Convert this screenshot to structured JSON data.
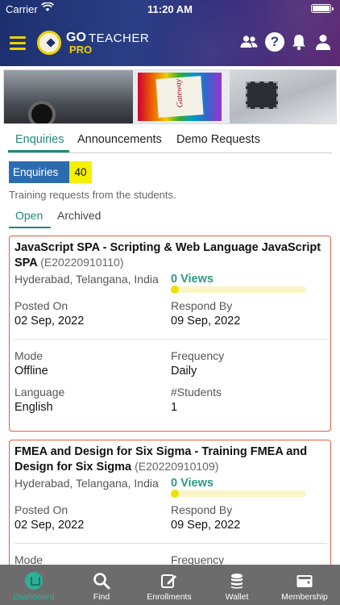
{
  "status_bar": {
    "carrier": "Carrier",
    "time": "11:20 AM"
  },
  "header": {
    "logo_go": "GO",
    "logo_teacher": "TEACHER",
    "logo_pro": "PRO",
    "icons": [
      "menu-icon",
      "users-icon",
      "help-icon",
      "bell-icon",
      "profile-icon"
    ]
  },
  "banner": {
    "board_text": "Gateway"
  },
  "tabs": [
    {
      "label": "Enquiries",
      "active": true
    },
    {
      "label": "Announcements",
      "active": false
    },
    {
      "label": "Demo Requests",
      "active": false
    }
  ],
  "enquiries": {
    "label": "Enquiries",
    "count": "40",
    "subtitle": "Training requests from the students.",
    "subtabs": [
      {
        "label": "Open",
        "active": true
      },
      {
        "label": "Archived",
        "active": false
      }
    ]
  },
  "cards": [
    {
      "title": "JavaScript SPA - Scripting & Web Language JavaScript SPA",
      "code": "(E20220910110)",
      "location": "Hyderabad, Telangana, India",
      "views": "0 Views",
      "posted_on_label": "Posted On",
      "posted_on": "02 Sep, 2022",
      "respond_by_label": "Respond By",
      "respond_by": "09 Sep, 2022",
      "mode_label": "Mode",
      "mode": "Offline",
      "frequency_label": "Frequency",
      "frequency": "Daily",
      "language_label": "Language",
      "language": "English",
      "students_label": "#Students",
      "students": "1"
    },
    {
      "title": "FMEA and Design for Six Sigma - Training FMEA and Design for Six Sigma",
      "code": "(E20220910109)",
      "location": "Hyderabad, Telangana, India",
      "views": "0 Views",
      "posted_on_label": "Posted On",
      "posted_on": "02 Sep, 2022",
      "respond_by_label": "Respond By",
      "respond_by": "09 Sep, 2022",
      "mode_label": "Mode",
      "frequency_label": "Frequency"
    }
  ],
  "bottom_nav": [
    {
      "label": "Dashboard",
      "icon": "home-icon",
      "active": true
    },
    {
      "label": "Find",
      "icon": "search-icon",
      "active": false
    },
    {
      "label": "Enrollments",
      "icon": "edit-icon",
      "active": false
    },
    {
      "label": "Wallet",
      "icon": "coins-icon",
      "active": false
    },
    {
      "label": "Membership",
      "icon": "wallet-icon",
      "active": false
    }
  ],
  "colors": {
    "accent": "#1f8a7a",
    "card_border": "#e0603c",
    "count_label_bg": "#2b6cb0",
    "count_badge_bg": "#f4f000",
    "views": "#2a9a86",
    "nav_bg": "#6c6c6c"
  }
}
